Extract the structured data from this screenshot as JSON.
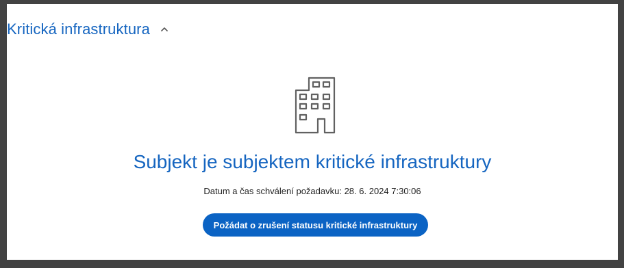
{
  "section": {
    "title": "Kritická infrastruktura",
    "expanded": true,
    "toggle_icon": "chevron-up-icon"
  },
  "status": {
    "icon": "building-icon",
    "title": "Subjekt je subjektem kritické infrastruktury",
    "approval_label": "Datum a čas schválení požadavku:",
    "approval_datetime": "28. 6. 2024 7:30:06",
    "approval_text": "Datum a čas schválení požadavku: 28. 6. 2024 7:30:06"
  },
  "actions": {
    "cancel_status_label": "Požádat o zrušení statusu kritické infrastruktury"
  },
  "colors": {
    "accent": "#1565c0",
    "button": "#0b63c4",
    "icon_stroke": "#616161",
    "frame": "#424242"
  }
}
